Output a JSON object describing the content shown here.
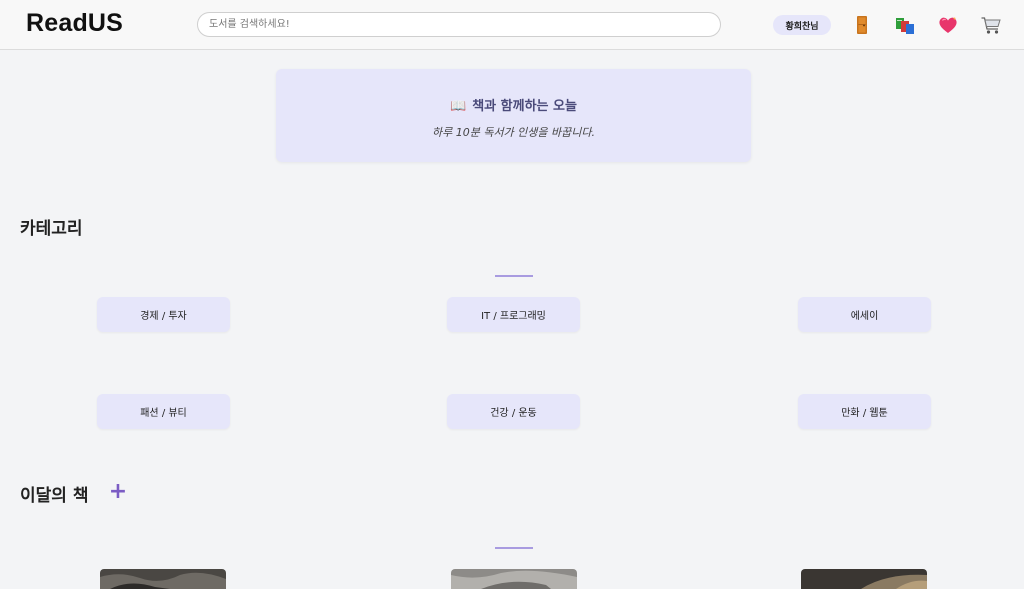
{
  "header": {
    "logo": "ReadUS",
    "search_placeholder": "도서를 검색하세요!",
    "user_name": "황희찬님",
    "icons": [
      "door-icon",
      "books-icon",
      "heart-icon",
      "cart-icon"
    ]
  },
  "banner": {
    "title": "책과 함께하는 오늘",
    "subtitle": "하루 10분 독서가 인생을 바꿉니다."
  },
  "categories": {
    "title": "카테고리",
    "items": [
      {
        "label": "경제 / 투자"
      },
      {
        "label": "IT / 프로그래밍"
      },
      {
        "label": "에세이"
      },
      {
        "label": "패션 / 뷰티"
      },
      {
        "label": "건강 / 운동"
      },
      {
        "label": "만화 / 웹툰"
      }
    ]
  },
  "monthly": {
    "title": "이달의 책",
    "plus": "+"
  },
  "colors": {
    "accent": "#e6e6fa",
    "divider": "#a89be0",
    "plus": "#7b5cc4"
  }
}
